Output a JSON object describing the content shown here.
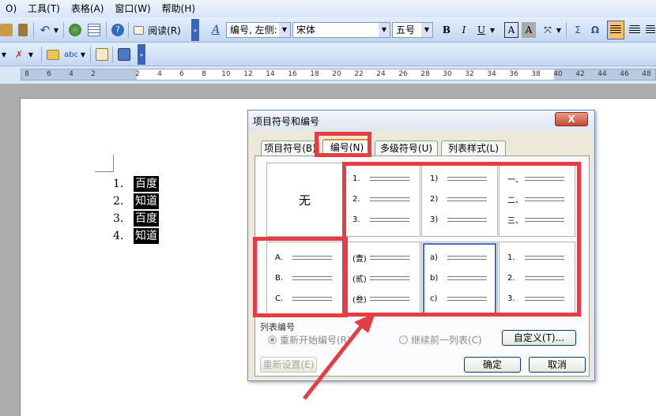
{
  "menubar": {
    "items": [
      "O)",
      "工具(T)",
      "表格(A)",
      "窗口(W)",
      "帮助(H)"
    ]
  },
  "toolbar": {
    "read_label": "阅读(R)",
    "style_combo": "编号, 左侧:",
    "font_combo": "宋体",
    "size_combo": "五号",
    "bold": "B",
    "italic": "I",
    "underline": "U",
    "char_border": "A",
    "char_shade": "A",
    "sigma": "Σ",
    "omega": "Ω"
  },
  "ruler": {
    "ticks": [
      "8",
      "6",
      "4",
      "2",
      "",
      "2",
      "4",
      "6",
      "8",
      "10",
      "12",
      "14",
      "16",
      "18",
      "20",
      "22",
      "24",
      "26",
      "28",
      "30",
      "32",
      "34",
      "36",
      "38",
      "40",
      "42",
      "44",
      "46",
      "48"
    ]
  },
  "document": {
    "list": [
      {
        "num": "1.",
        "text": "百度"
      },
      {
        "num": "2.",
        "text": "知道"
      },
      {
        "num": "3.",
        "text": "百度"
      },
      {
        "num": "4.",
        "text": "知道"
      }
    ]
  },
  "dialog": {
    "title": "项目符号和编号",
    "close": "X",
    "tabs": [
      "项目符号(B)",
      "编号(N)",
      "多级符号(U)",
      "列表样式(L)"
    ],
    "active_tab": 1,
    "none_label": "无",
    "gallery": [
      {
        "labels": [
          "1.",
          "2.",
          "3."
        ]
      },
      {
        "labels": [
          "1)",
          "2)",
          "3)"
        ]
      },
      {
        "labels": [
          "一、",
          "二、",
          "三、"
        ]
      },
      {
        "labels": [
          "A.",
          "B.",
          "C."
        ]
      },
      {
        "labels": [
          "(壹)",
          "(贰)",
          "(叁)"
        ]
      },
      {
        "labels": [
          "a)",
          "b)",
          "c)"
        ]
      },
      {
        "labels": [
          "1.",
          "2.",
          "3."
        ]
      }
    ],
    "list_numbering_label": "列表编号",
    "restart_label": "重新开始编号(R)",
    "continue_label": "继续前一列表(C)",
    "customize_label": "自定义(T)...",
    "reset_label": "重新设置(E)",
    "ok_label": "确定",
    "cancel_label": "取消"
  },
  "colors": {
    "highlight_red": "#e63c43",
    "selection_blue": "#3b6ecf"
  }
}
